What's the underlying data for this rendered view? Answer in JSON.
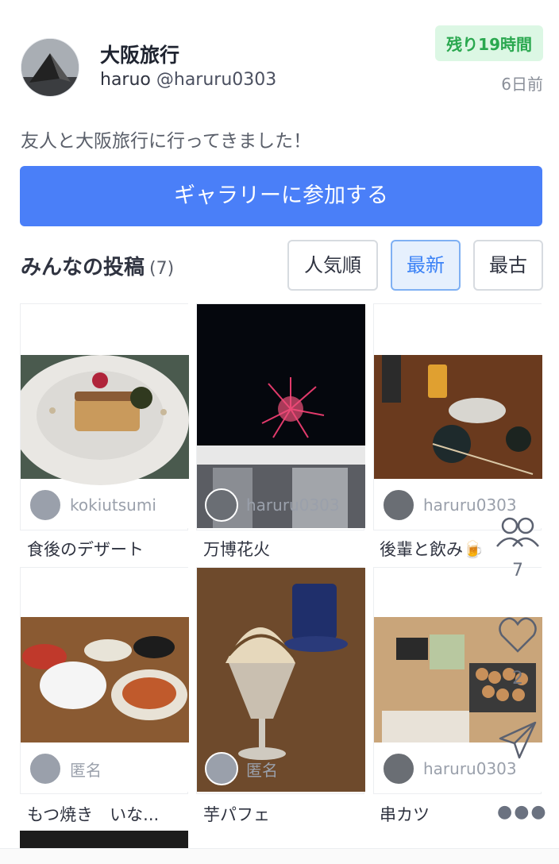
{
  "gallery": {
    "title": "大阪旅行",
    "author_name": "haruo",
    "author_handle": "@haruru0303",
    "badge": "残り19時間",
    "posted_ago": "6日前",
    "description": "友人と大阪旅行に行ってきました！",
    "join_label": "ギャラリーに参加する"
  },
  "posts_section": {
    "title": "みんなの投稿",
    "count": "(7)",
    "sort_options": [
      "人気順",
      "最新",
      "最古"
    ],
    "active_sort": "最新"
  },
  "posts": [
    {
      "username": "kokiutsumi",
      "caption": "食後のデザート"
    },
    {
      "username": "haruru0303",
      "caption": "万博花火"
    },
    {
      "username": "haruru0303",
      "caption": "後輩と飲み🍺"
    },
    {
      "username": "匿名",
      "caption": "もつ焼き　いな..."
    },
    {
      "username": "匿名",
      "caption": "芋パフェ"
    },
    {
      "username": "haruru0303",
      "caption": "串カツ"
    }
  ],
  "float_actions": {
    "participants_count": "7",
    "likes_count": "2",
    "participants_icon": "people-icon",
    "like_icon": "heart-icon",
    "share_icon": "send-icon",
    "more_icon": "more-dots-icon"
  },
  "colors": {
    "accent": "#4a7ff8",
    "badge_bg": "#dcf7e4",
    "badge_text": "#2aa84f",
    "active_sort_bg": "#e6f0fd"
  }
}
